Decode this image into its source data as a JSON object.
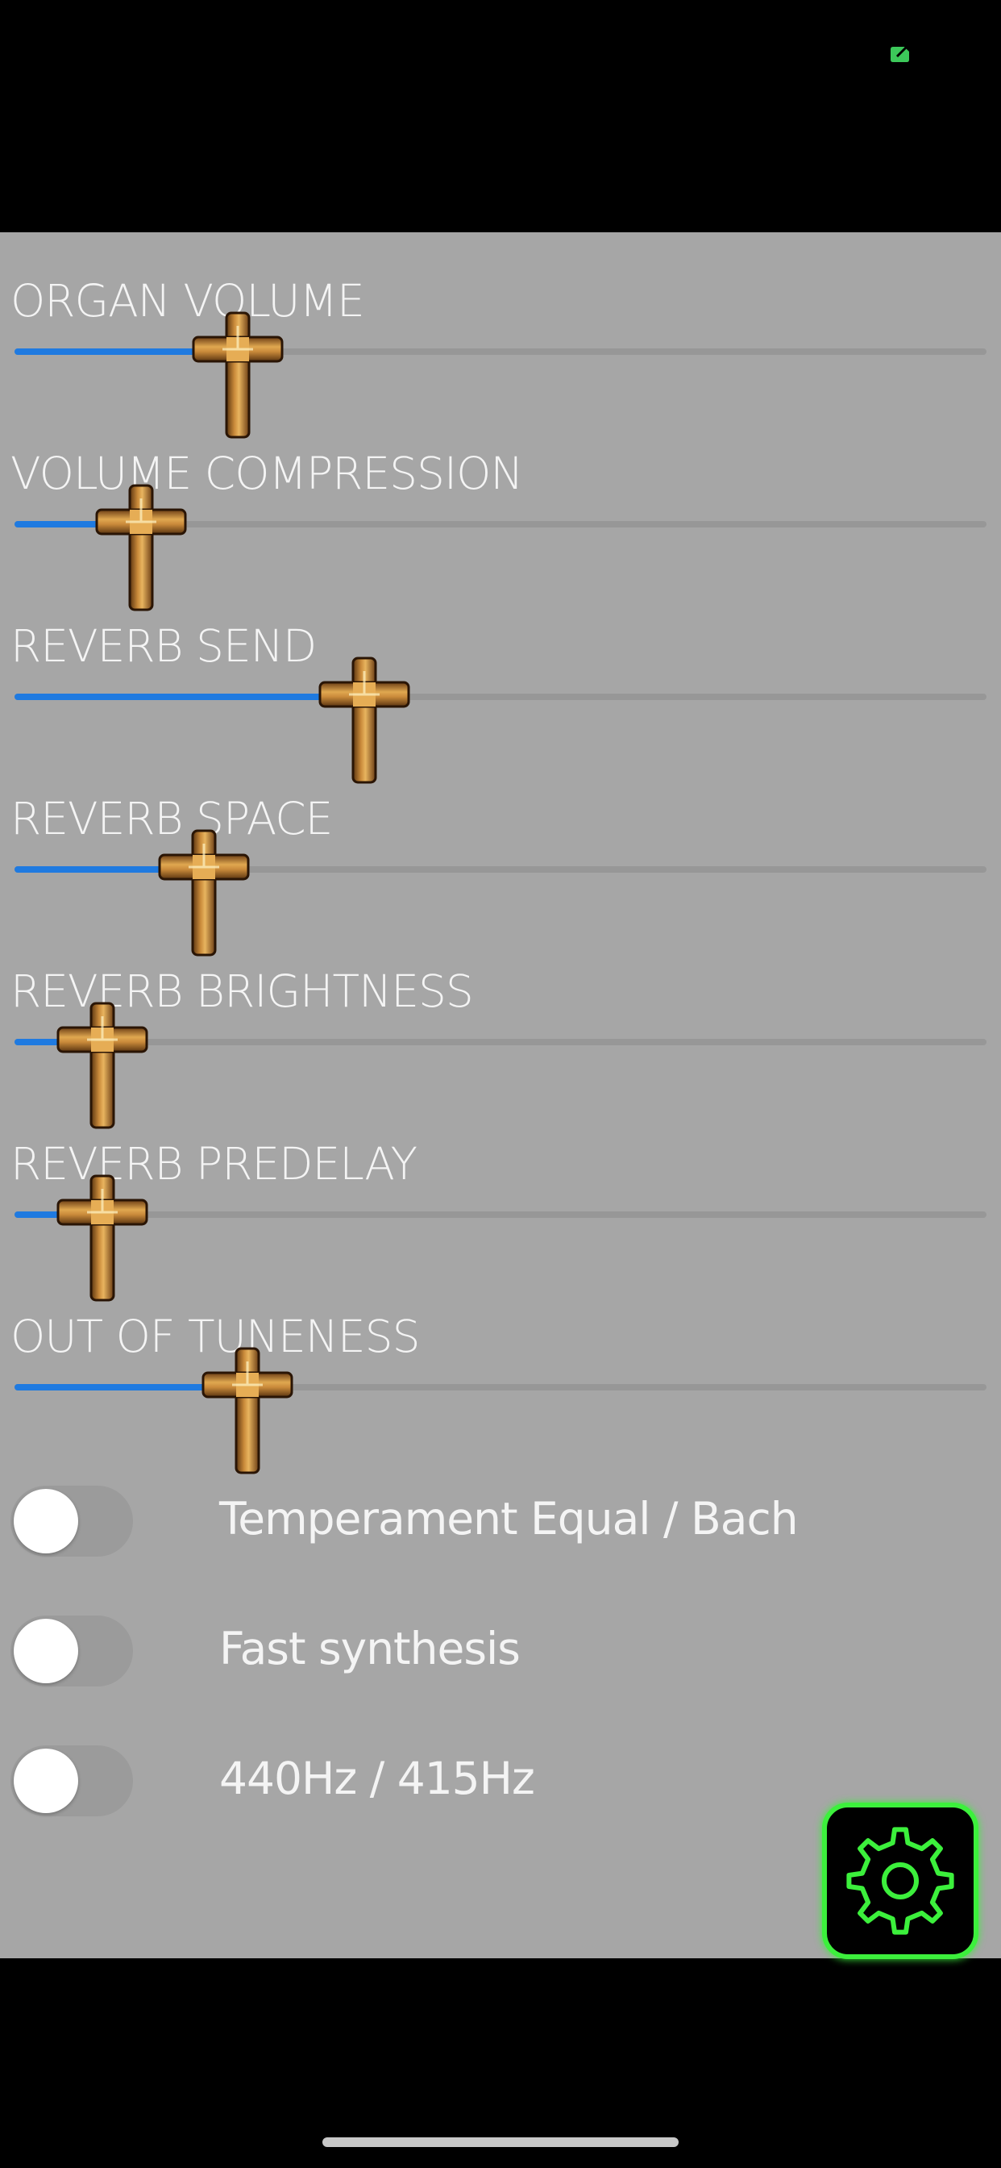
{
  "sliders": [
    {
      "label": "ORGAN VOLUME",
      "value": 0.23
    },
    {
      "label": "VOLUME COMPRESSION",
      "value": 0.13
    },
    {
      "label": "REVERB SEND",
      "value": 0.36
    },
    {
      "label": "REVERB SPACE",
      "value": 0.195
    },
    {
      "label": "REVERB BRIGHTNESS",
      "value": 0.09
    },
    {
      "label": "REVERB PREDELAY",
      "value": 0.09
    },
    {
      "label": "OUT OF TUNENESS",
      "value": 0.24
    }
  ],
  "toggles": [
    {
      "label": "Temperament Equal / Bach",
      "on": false
    },
    {
      "label": "Fast synthesis",
      "on": false
    },
    {
      "label": "440Hz / 415Hz",
      "on": false
    }
  ],
  "colors": {
    "panel": "#a6a6a6",
    "slider_fill": "#1f7ae0",
    "slider_track": "#979797",
    "settings_glow": "#3cf03c",
    "status_indicator": "#3cc85a"
  },
  "icons": {
    "slider_thumb": "cross-icon",
    "settings": "gear-icon",
    "status": "battery-indicator-icon"
  }
}
